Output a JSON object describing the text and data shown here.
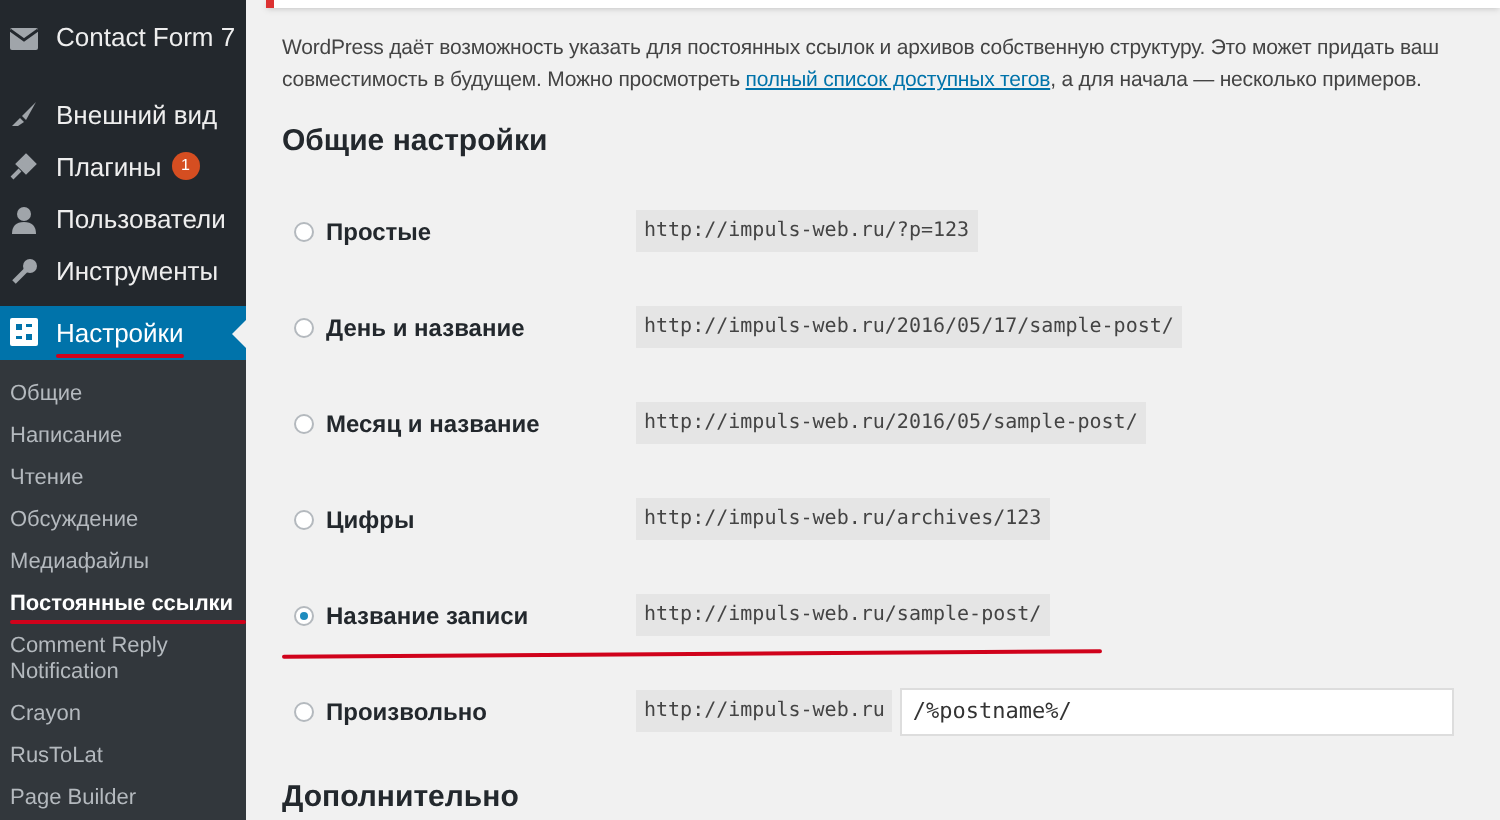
{
  "sidebar": {
    "items": [
      {
        "label": "Contact Form 7",
        "selected": false
      },
      {
        "label": "Внешний вид",
        "selected": false
      },
      {
        "label": "Плагины",
        "badge": "1",
        "selected": false
      },
      {
        "label": "Пользователи",
        "selected": false
      },
      {
        "label": "Инструменты",
        "selected": false
      },
      {
        "label": "Настройки",
        "selected": true,
        "underlined": true,
        "children": [
          {
            "label": "Общие",
            "selected": false,
            "underlined": false
          },
          {
            "label": "Написание",
            "selected": false,
            "underlined": false
          },
          {
            "label": "Чтение",
            "selected": false,
            "underlined": false
          },
          {
            "label": "Обсуждение",
            "selected": false,
            "underlined": false
          },
          {
            "label": "Медиафайлы",
            "selected": false,
            "underlined": false
          },
          {
            "label": "Постоянные ссылки",
            "selected": true,
            "underlined": true
          },
          {
            "label": "Comment Reply Notification",
            "selected": false,
            "underlined": false
          },
          {
            "label": "Crayon",
            "selected": false,
            "underlined": false
          },
          {
            "label": "RusToLat",
            "selected": false,
            "underlined": false
          },
          {
            "label": "Page Builder",
            "selected": false,
            "underlined": false
          }
        ]
      }
    ]
  },
  "intro": {
    "text_before": "WordPress даёт возможность указать для постоянных ссылок и архивов собственную структуру. Это может придать ваш",
    "text_line2": "совместимость в будущем. Можно просмотреть",
    "link": "полный список доступных тегов",
    "text_after": ", а для начала — несколько примеров."
  },
  "section_title": "Общие настройки",
  "options": [
    {
      "label": "Простые",
      "example": "http://impuls-web.ru/?p=123",
      "selected": false,
      "underlined": false
    },
    {
      "label": "День и название",
      "example": "http://impuls-web.ru/2016/05/17/sample-post/",
      "selected": false,
      "underlined": false
    },
    {
      "label": "Месяц и название",
      "example": "http://impuls-web.ru/2016/05/sample-post/",
      "selected": false,
      "underlined": false
    },
    {
      "label": "Цифры",
      "example": "http://impuls-web.ru/archives/123",
      "selected": false,
      "underlined": false
    },
    {
      "label": "Название записи",
      "example": "http://impuls-web.ru/sample-post/",
      "selected": true,
      "underlined": true
    },
    {
      "label": "Произвольно",
      "example": "http://impuls-web.ru",
      "value": "/%postname%/",
      "selected": false,
      "underlined": false
    }
  ],
  "next_section_title": "Дополнительно"
}
